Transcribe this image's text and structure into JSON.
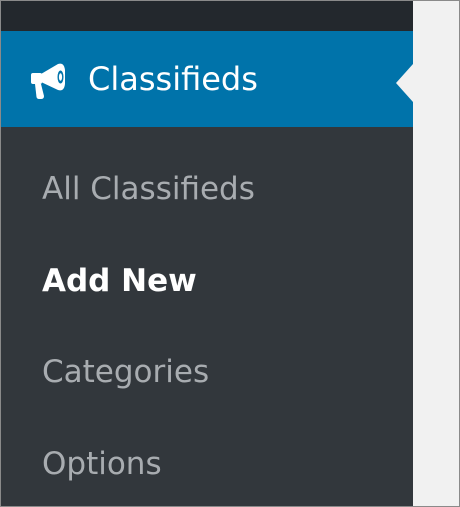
{
  "menu": {
    "title": "Classifieds",
    "icon": "megaphone-icon",
    "accent_color": "#0073aa",
    "background_color": "#32373c",
    "items": [
      {
        "label": "All Classifieds",
        "current": false
      },
      {
        "label": "Add New",
        "current": true
      },
      {
        "label": "Categories",
        "current": false
      },
      {
        "label": "Options",
        "current": false
      }
    ]
  }
}
